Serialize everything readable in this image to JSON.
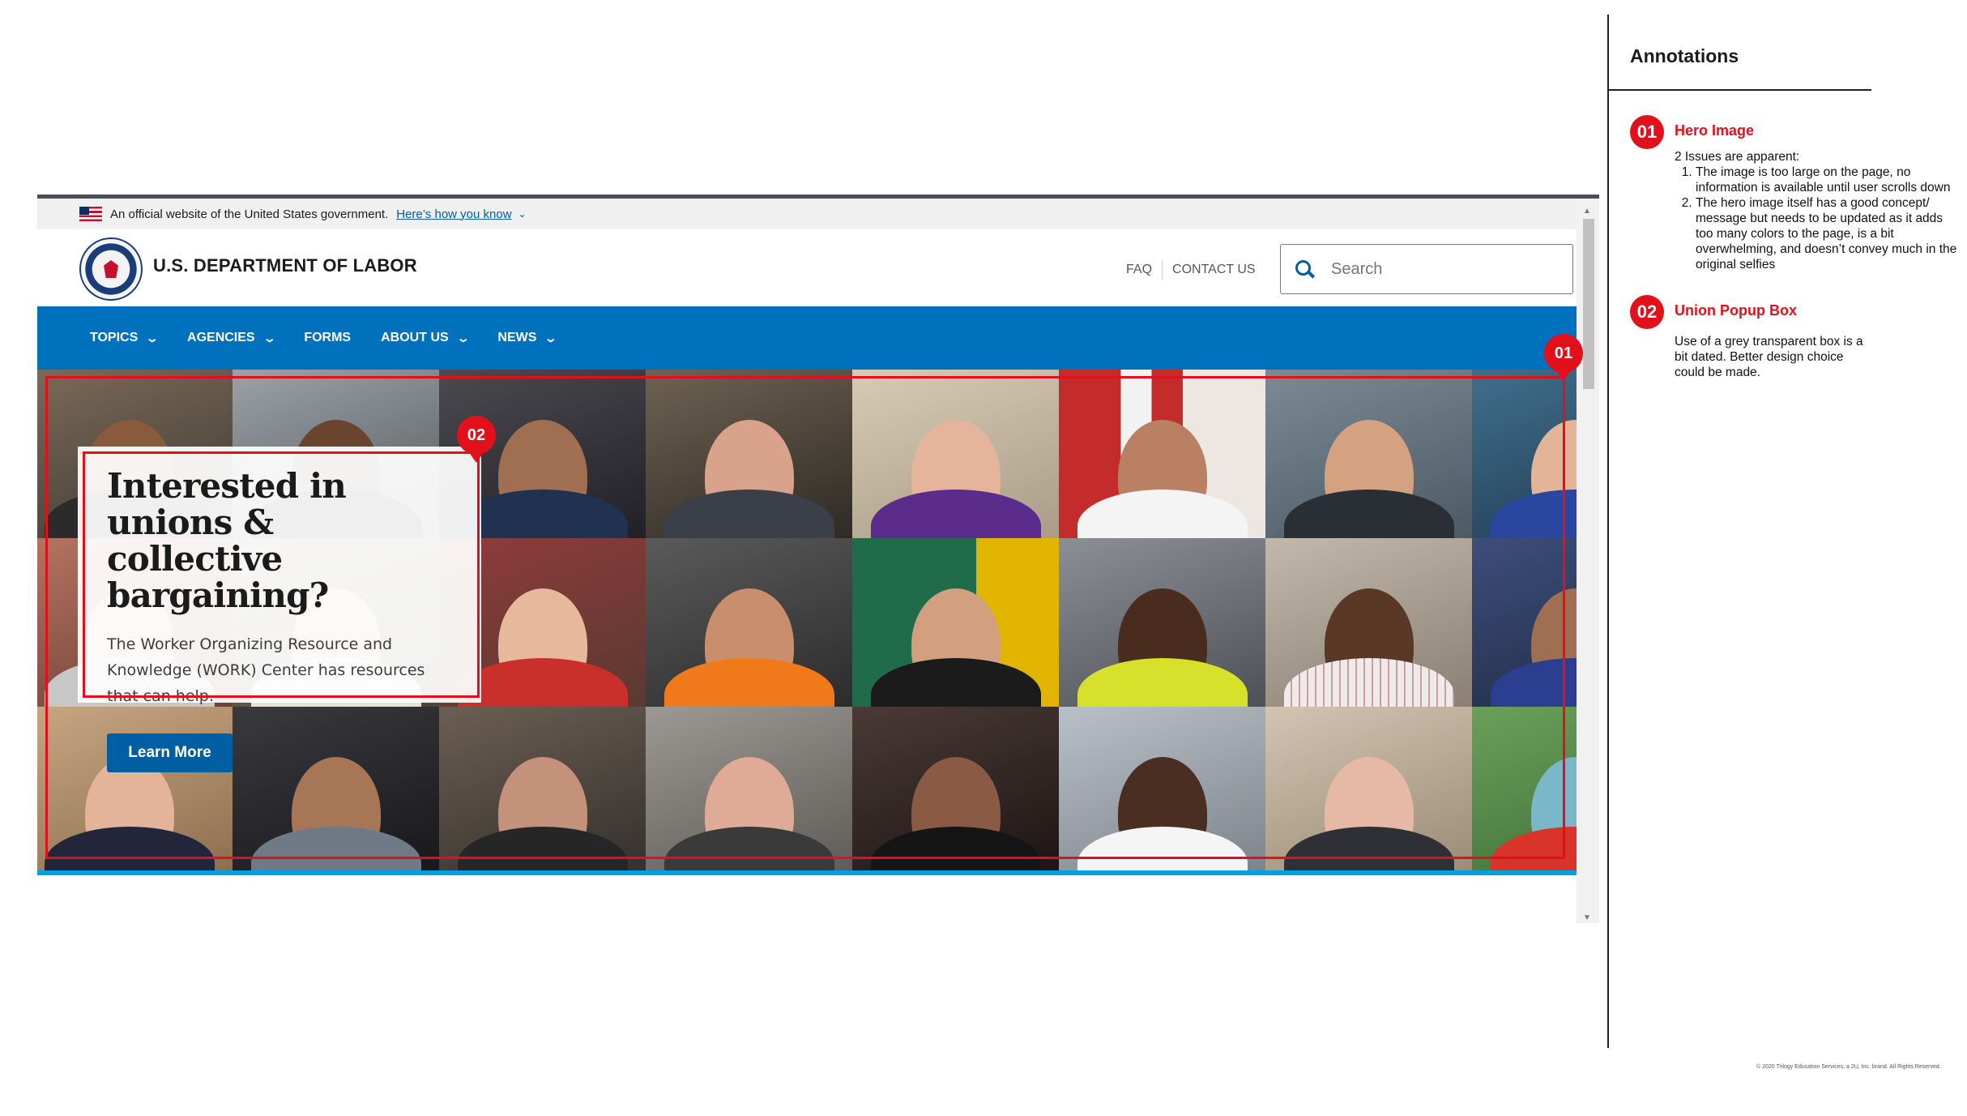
{
  "gov_banner": {
    "text": "An official website of the United States government.",
    "link": "Here’s how you know"
  },
  "header": {
    "agency_title": "U.S. DEPARTMENT OF LABOR",
    "faq": "FAQ",
    "contact": "CONTACT US",
    "search_placeholder": "Search"
  },
  "nav": {
    "items": [
      {
        "label": "TOPICS",
        "chevron": true
      },
      {
        "label": "AGENCIES",
        "chevron": true
      },
      {
        "label": "FORMS",
        "chevron": false
      },
      {
        "label": "ABOUT US",
        "chevron": true
      },
      {
        "label": "NEWS",
        "chevron": true
      }
    ]
  },
  "hero": {
    "title": "Interested in unions & collective bargaining?",
    "body": "The Worker Organizing Resource and Knowledge (WORK) Center has resources that can help.",
    "button": "Learn More"
  },
  "markers": {
    "one": "01",
    "two": "02"
  },
  "annotations": {
    "title": "Annotations",
    "items": [
      {
        "number": "01",
        "heading": "Hero Image",
        "intro": "2 Issues are apparent:",
        "points": [
          "The image is too large on the page, no information is available until user scrolls down",
          "The hero image itself has a good concept/ message but needs to be updated as it adds too many colors to the page, is a bit overwhelming, and doesn’t convey much in the original selfies"
        ]
      },
      {
        "number": "02",
        "heading": "Union Popup Box",
        "text": "Use of a grey transparent box is a bit dated. Better design choice could be made."
      }
    ]
  },
  "footer": {
    "copyright": "© 2020 Trilogy Education Services, a 2U, Inc. brand. All Rights Reserved."
  },
  "colors": {
    "nav_blue": "#0071bc",
    "link_blue": "#005ea2",
    "annotation_red": "#e2101b"
  }
}
